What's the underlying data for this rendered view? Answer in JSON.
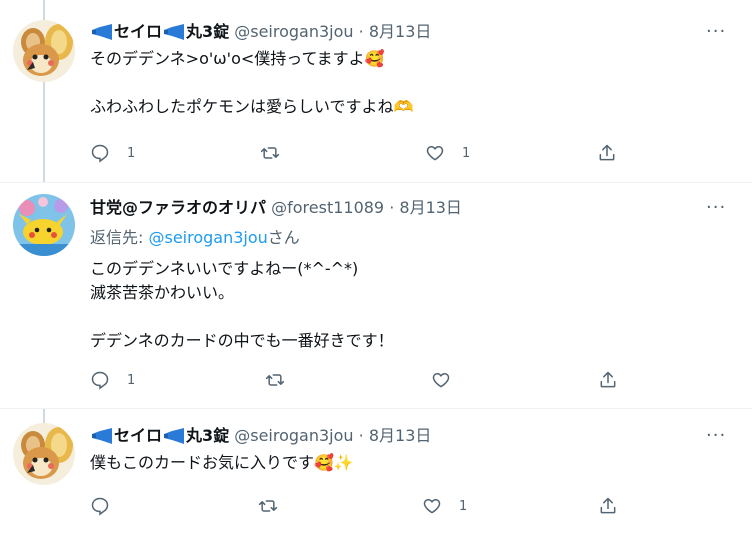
{
  "tweets": [
    {
      "name_prefix": "",
      "name": "セイロ",
      "name_mid": "丸3錠",
      "handle": "@seirogan3jou",
      "sep": "·",
      "date": "8月13日",
      "text": "そのデデンネ>o'ω'o<僕持ってますよ🥰\n\nふわふわしたポケモンは愛らしいですよね🫶",
      "replies": "1",
      "retweets": "",
      "likes": "1"
    },
    {
      "name": "甘党@ファラオのオリパ",
      "handle": "@forest11089",
      "sep": "·",
      "date": "8月13日",
      "reply_prefix": "返信先: ",
      "reply_mention": "@seirogan3jou",
      "reply_suffix": "さん",
      "text": "このデデンネいいですよねー(*^-^*)\n滅茶苦茶かわいい。\n\nデデンネのカードの中でも一番好きです！",
      "replies": "1",
      "retweets": "",
      "likes": ""
    },
    {
      "name": "セイロ",
      "name_mid": "丸3錠",
      "handle": "@seirogan3jou",
      "sep": "·",
      "date": "8月13日",
      "text": "僕もこのカードお気に入りです🥰✨",
      "replies": "",
      "retweets": "",
      "likes": "1"
    }
  ],
  "more_label": "···",
  "icons": {
    "reply": "reply-icon",
    "retweet": "retweet-icon",
    "like": "heart-icon",
    "share": "share-icon",
    "more": "more-icon",
    "badge": "megaphone-icon"
  },
  "colors": {
    "text": "#0f1419",
    "secondary": "#536471",
    "link": "#1d9bf0",
    "divider": "#eff3f4",
    "thread_line": "#cfd9de"
  }
}
